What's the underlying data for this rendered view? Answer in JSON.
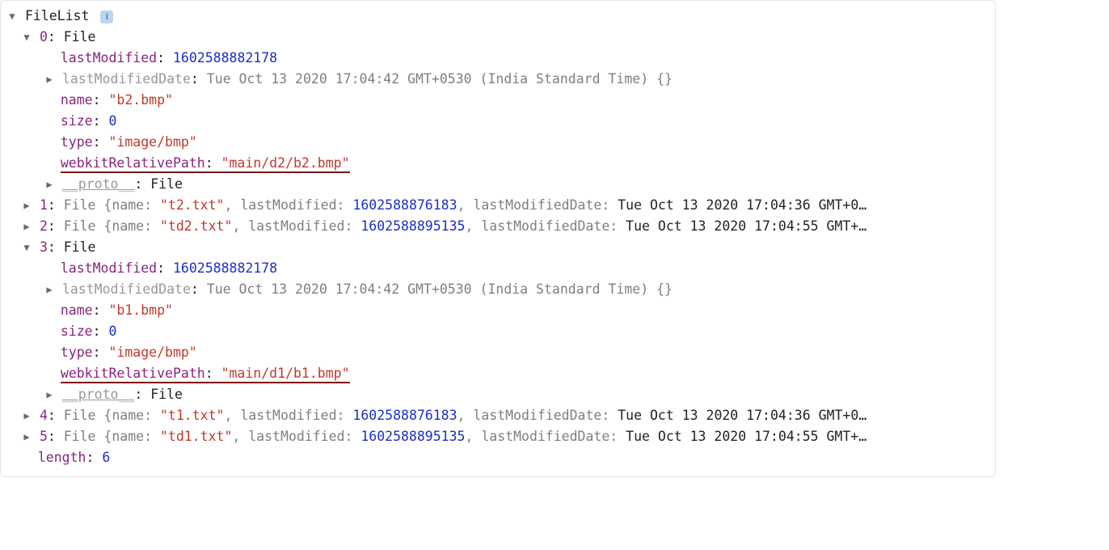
{
  "rootLabel": "FileList",
  "infoGlyph": "i",
  "labels": {
    "lastModified": "lastModified",
    "lastModifiedDate": "lastModifiedDate",
    "name": "name",
    "size": "size",
    "type": "type",
    "webkitRelativePath": "webkitRelativePath",
    "proto": "__proto__",
    "protoValue": "File",
    "file": "File",
    "braces": "{}",
    "length": "length"
  },
  "length": 6,
  "items": {
    "0": {
      "lastModified": 1602588882178,
      "lastModifiedDate": "Tue Oct 13 2020 17:04:42 GMT+0530 (India Standard Time)",
      "name": "\"b2.bmp\"",
      "size": 0,
      "type": "\"image/bmp\"",
      "webkitRelativePath": "\"main/d2/b2.bmp\""
    },
    "1": {
      "summary_pre": "File {name: ",
      "summary_name": "\"t2.txt\"",
      "summary_mid1": ", lastModified: ",
      "summary_lm": 1602588876183,
      "summary_mid2": ", lastModifiedDate: ",
      "summary_lmd": "Tue Oct 13 2020 17:04:36 GMT+0…"
    },
    "2": {
      "summary_pre": "File {name: ",
      "summary_name": "\"td2.txt\"",
      "summary_mid1": ", lastModified: ",
      "summary_lm": 1602588895135,
      "summary_mid2": ", lastModifiedDate: ",
      "summary_lmd": "Tue Oct 13 2020 17:04:55 GMT+…"
    },
    "3": {
      "lastModified": 1602588882178,
      "lastModifiedDate": "Tue Oct 13 2020 17:04:42 GMT+0530 (India Standard Time)",
      "name": "\"b1.bmp\"",
      "size": 0,
      "type": "\"image/bmp\"",
      "webkitRelativePath": "\"main/d1/b1.bmp\""
    },
    "4": {
      "summary_pre": "File {name: ",
      "summary_name": "\"t1.txt\"",
      "summary_mid1": ", lastModified: ",
      "summary_lm": 1602588876183,
      "summary_mid2": ", lastModifiedDate: ",
      "summary_lmd": "Tue Oct 13 2020 17:04:36 GMT+0…"
    },
    "5": {
      "summary_pre": "File {name: ",
      "summary_name": "\"td1.txt\"",
      "summary_mid1": ", lastModified: ",
      "summary_lm": 1602588895135,
      "summary_mid2": ", lastModifiedDate: ",
      "summary_lmd": "Tue Oct 13 2020 17:04:55 GMT+…"
    }
  },
  "idx": {
    "0": "0",
    "1": "1",
    "2": "2",
    "3": "3",
    "4": "4",
    "5": "5"
  }
}
